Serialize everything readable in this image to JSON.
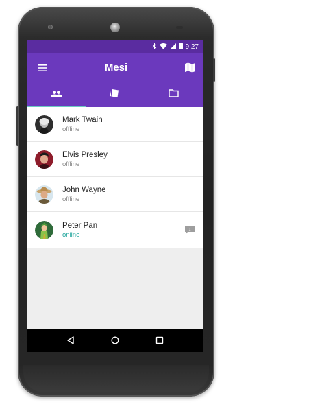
{
  "statusbar": {
    "time": "9:27",
    "bluetooth_icon": "bluetooth-icon",
    "wifi_icon": "wifi-icon",
    "signal_icon": "signal-icon",
    "battery_icon": "battery-icon"
  },
  "appbar": {
    "title": "Mesi",
    "menu_icon": "menu-icon",
    "map_icon": "map-icon"
  },
  "tabs": [
    {
      "icon": "people-icon",
      "active": true
    },
    {
      "icon": "cards-icon",
      "active": false
    },
    {
      "icon": "folder-icon",
      "active": false
    }
  ],
  "contacts": [
    {
      "name": "Mark Twain",
      "status": "offline"
    },
    {
      "name": "Elvis Presley",
      "status": "offline"
    },
    {
      "name": "John Wayne",
      "status": "offline"
    },
    {
      "name": "Peter Pan",
      "status": "online",
      "unread": "1"
    }
  ],
  "navbar": {
    "back_icon": "back-icon",
    "home_icon": "home-icon",
    "recents_icon": "recents-icon"
  },
  "colors": {
    "statusbar": "#5a2ca0",
    "appbar": "#6b39bd",
    "tab_indicator": "#6bc9c4",
    "online": "#1aa39a"
  }
}
